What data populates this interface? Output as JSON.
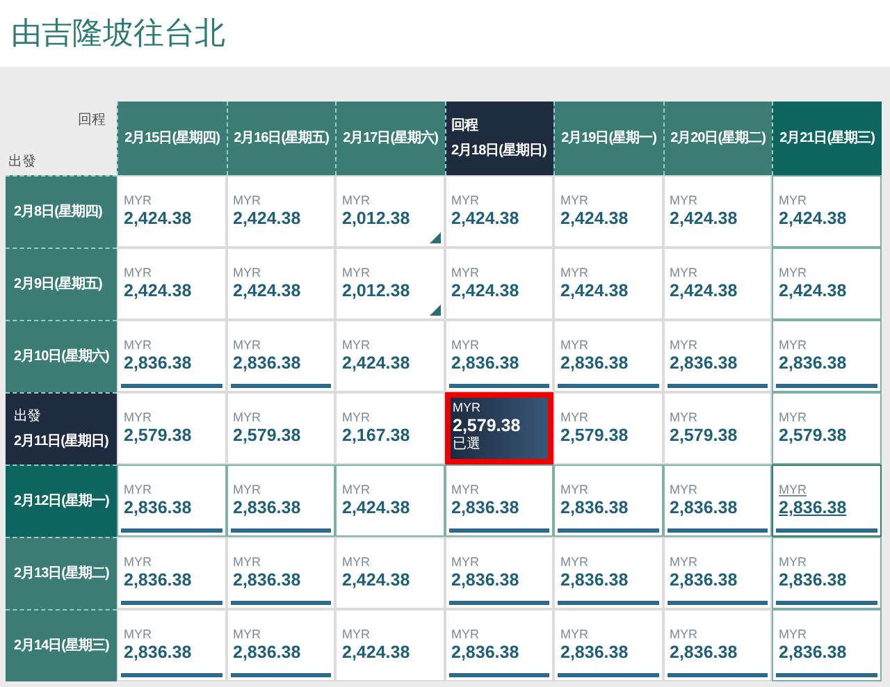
{
  "title": "由吉隆坡往台北",
  "corner": {
    "return_label": "回程",
    "depart_label": "出發"
  },
  "columns": [
    {
      "label": "2月15日(星期四)",
      "selected": false,
      "hovered": false
    },
    {
      "label": "2月16日(星期五)",
      "selected": false,
      "hovered": false
    },
    {
      "label": "2月17日(星期六)",
      "selected": false,
      "hovered": false
    },
    {
      "label": "2月18日(星期日)",
      "caption": "回程",
      "selected": true,
      "hovered": false
    },
    {
      "label": "2月19日(星期一)",
      "selected": false,
      "hovered": false
    },
    {
      "label": "2月20日(星期二)",
      "selected": false,
      "hovered": false
    },
    {
      "label": "2月21日(星期三)",
      "selected": false,
      "hovered": true
    }
  ],
  "rows": [
    {
      "label": "2月8日(星期四)",
      "selected": false,
      "hovered": false,
      "cells": [
        {
          "currency": "MYR",
          "price": "2,424.38",
          "bar": false,
          "flag": false,
          "selected": false,
          "hovered": false
        },
        {
          "currency": "MYR",
          "price": "2,424.38",
          "bar": false,
          "flag": false,
          "selected": false,
          "hovered": false
        },
        {
          "currency": "MYR",
          "price": "2,012.38",
          "bar": false,
          "flag": true,
          "selected": false,
          "hovered": false
        },
        {
          "currency": "MYR",
          "price": "2,424.38",
          "bar": false,
          "flag": false,
          "selected": false,
          "hovered": false
        },
        {
          "currency": "MYR",
          "price": "2,424.38",
          "bar": false,
          "flag": false,
          "selected": false,
          "hovered": false
        },
        {
          "currency": "MYR",
          "price": "2,424.38",
          "bar": false,
          "flag": false,
          "selected": false,
          "hovered": false
        },
        {
          "currency": "MYR",
          "price": "2,424.38",
          "bar": false,
          "flag": false,
          "selected": false,
          "hovered": false
        }
      ]
    },
    {
      "label": "2月9日(星期五)",
      "selected": false,
      "hovered": false,
      "cells": [
        {
          "currency": "MYR",
          "price": "2,424.38",
          "bar": false,
          "flag": false,
          "selected": false,
          "hovered": false
        },
        {
          "currency": "MYR",
          "price": "2,424.38",
          "bar": false,
          "flag": false,
          "selected": false,
          "hovered": false
        },
        {
          "currency": "MYR",
          "price": "2,012.38",
          "bar": false,
          "flag": true,
          "selected": false,
          "hovered": false
        },
        {
          "currency": "MYR",
          "price": "2,424.38",
          "bar": false,
          "flag": false,
          "selected": false,
          "hovered": false
        },
        {
          "currency": "MYR",
          "price": "2,424.38",
          "bar": false,
          "flag": false,
          "selected": false,
          "hovered": false
        },
        {
          "currency": "MYR",
          "price": "2,424.38",
          "bar": false,
          "flag": false,
          "selected": false,
          "hovered": false
        },
        {
          "currency": "MYR",
          "price": "2,424.38",
          "bar": false,
          "flag": false,
          "selected": false,
          "hovered": false
        }
      ]
    },
    {
      "label": "2月10日(星期六)",
      "selected": false,
      "hovered": false,
      "cells": [
        {
          "currency": "MYR",
          "price": "2,836.38",
          "bar": true,
          "flag": false,
          "selected": false,
          "hovered": false
        },
        {
          "currency": "MYR",
          "price": "2,836.38",
          "bar": true,
          "flag": false,
          "selected": false,
          "hovered": false
        },
        {
          "currency": "MYR",
          "price": "2,424.38",
          "bar": false,
          "flag": false,
          "selected": false,
          "hovered": false
        },
        {
          "currency": "MYR",
          "price": "2,836.38",
          "bar": true,
          "flag": false,
          "selected": false,
          "hovered": false
        },
        {
          "currency": "MYR",
          "price": "2,836.38",
          "bar": true,
          "flag": false,
          "selected": false,
          "hovered": false
        },
        {
          "currency": "MYR",
          "price": "2,836.38",
          "bar": true,
          "flag": false,
          "selected": false,
          "hovered": false
        },
        {
          "currency": "MYR",
          "price": "2,836.38",
          "bar": true,
          "flag": false,
          "selected": false,
          "hovered": false
        }
      ]
    },
    {
      "label": "2月11日(星期日)",
      "caption": "出發",
      "selected": true,
      "hovered": false,
      "cells": [
        {
          "currency": "MYR",
          "price": "2,579.38",
          "bar": false,
          "flag": false,
          "selected": false,
          "hovered": false
        },
        {
          "currency": "MYR",
          "price": "2,579.38",
          "bar": false,
          "flag": false,
          "selected": false,
          "hovered": false
        },
        {
          "currency": "MYR",
          "price": "2,167.38",
          "bar": false,
          "flag": false,
          "selected": false,
          "hovered": false
        },
        {
          "currency": "MYR",
          "price": "2,579.38",
          "note": "已選",
          "bar": false,
          "flag": false,
          "selected": true,
          "hovered": false
        },
        {
          "currency": "MYR",
          "price": "2,579.38",
          "bar": false,
          "flag": false,
          "selected": false,
          "hovered": false
        },
        {
          "currency": "MYR",
          "price": "2,579.38",
          "bar": false,
          "flag": false,
          "selected": false,
          "hovered": false
        },
        {
          "currency": "MYR",
          "price": "2,579.38",
          "bar": false,
          "flag": false,
          "selected": false,
          "hovered": false
        }
      ]
    },
    {
      "label": "2月12日(星期一)",
      "selected": false,
      "hovered": true,
      "cells": [
        {
          "currency": "MYR",
          "price": "2,836.38",
          "bar": true,
          "flag": false,
          "selected": false,
          "hovered": false
        },
        {
          "currency": "MYR",
          "price": "2,836.38",
          "bar": true,
          "flag": false,
          "selected": false,
          "hovered": false
        },
        {
          "currency": "MYR",
          "price": "2,424.38",
          "bar": false,
          "flag": false,
          "selected": false,
          "hovered": false
        },
        {
          "currency": "MYR",
          "price": "2,836.38",
          "bar": true,
          "flag": false,
          "selected": false,
          "hovered": false
        },
        {
          "currency": "MYR",
          "price": "2,836.38",
          "bar": true,
          "flag": false,
          "selected": false,
          "hovered": false
        },
        {
          "currency": "MYR",
          "price": "2,836.38",
          "bar": true,
          "flag": false,
          "selected": false,
          "hovered": false
        },
        {
          "currency": "MYR",
          "price": "2,836.38",
          "bar": true,
          "flag": false,
          "selected": false,
          "hovered": true
        }
      ]
    },
    {
      "label": "2月13日(星期二)",
      "selected": false,
      "hovered": false,
      "cells": [
        {
          "currency": "MYR",
          "price": "2,836.38",
          "bar": true,
          "flag": false,
          "selected": false,
          "hovered": false
        },
        {
          "currency": "MYR",
          "price": "2,836.38",
          "bar": true,
          "flag": false,
          "selected": false,
          "hovered": false
        },
        {
          "currency": "MYR",
          "price": "2,424.38",
          "bar": false,
          "flag": false,
          "selected": false,
          "hovered": false
        },
        {
          "currency": "MYR",
          "price": "2,836.38",
          "bar": true,
          "flag": false,
          "selected": false,
          "hovered": false
        },
        {
          "currency": "MYR",
          "price": "2,836.38",
          "bar": true,
          "flag": false,
          "selected": false,
          "hovered": false
        },
        {
          "currency": "MYR",
          "price": "2,836.38",
          "bar": true,
          "flag": false,
          "selected": false,
          "hovered": false
        },
        {
          "currency": "MYR",
          "price": "2,836.38",
          "bar": true,
          "flag": false,
          "selected": false,
          "hovered": false
        }
      ]
    },
    {
      "label": "2月14日(星期三)",
      "selected": false,
      "hovered": false,
      "cells": [
        {
          "currency": "MYR",
          "price": "2,836.38",
          "bar": true,
          "flag": false,
          "selected": false,
          "hovered": false
        },
        {
          "currency": "MYR",
          "price": "2,836.38",
          "bar": true,
          "flag": false,
          "selected": false,
          "hovered": false
        },
        {
          "currency": "MYR",
          "price": "2,424.38",
          "bar": false,
          "flag": false,
          "selected": false,
          "hovered": false
        },
        {
          "currency": "MYR",
          "price": "2,836.38",
          "bar": true,
          "flag": false,
          "selected": false,
          "hovered": false
        },
        {
          "currency": "MYR",
          "price": "2,836.38",
          "bar": true,
          "flag": false,
          "selected": false,
          "hovered": false
        },
        {
          "currency": "MYR",
          "price": "2,836.38",
          "bar": true,
          "flag": false,
          "selected": false,
          "hovered": false
        },
        {
          "currency": "MYR",
          "price": "2,836.38",
          "bar": true,
          "flag": false,
          "selected": false,
          "hovered": false
        }
      ]
    }
  ]
}
